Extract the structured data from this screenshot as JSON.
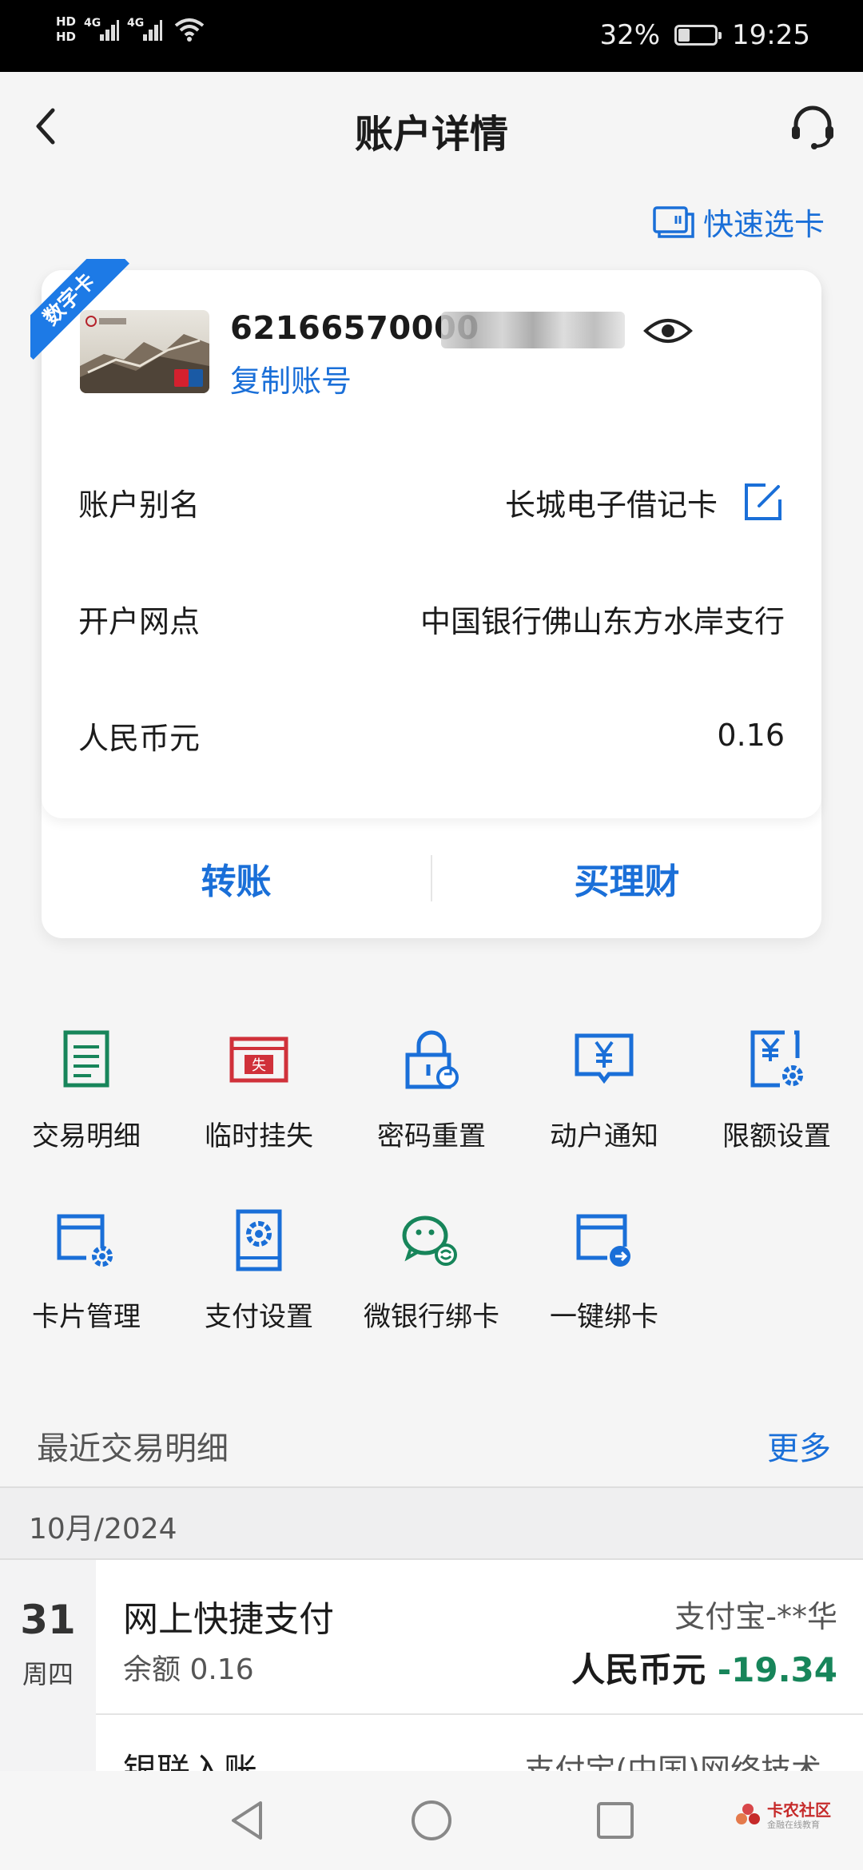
{
  "status_bar": {
    "battery": "32%",
    "battery_level": 0.32,
    "time": "19:25",
    "hd1": "HD",
    "hd2": "HD",
    "net1": "4G",
    "net2": "4G"
  },
  "header": {
    "title": "账户详情",
    "back_icon": "chevron-left-icon",
    "service_icon": "headset-icon"
  },
  "quick_select": {
    "label": "快速选卡",
    "icon": "card-select-icon"
  },
  "card": {
    "badge": "数字卡",
    "account_number": "62166570000",
    "copy_label": "复制账号",
    "rows": [
      {
        "label": "账户别名",
        "value": "长城电子借记卡"
      },
      {
        "label": "开户网点",
        "value": "中国银行佛山东方水岸支行"
      },
      {
        "label": "人民币元",
        "value": "0.16"
      }
    ],
    "actions": {
      "transfer": "转账",
      "buy": "买理财"
    }
  },
  "functions": [
    {
      "label": "交易明细",
      "icon": "ledger-icon",
      "color": "#17855a"
    },
    {
      "label": "临时挂失",
      "icon": "report-loss-icon",
      "color": "#d0313a"
    },
    {
      "label": "密码重置",
      "icon": "lock-reset-icon",
      "color": "#1a6fd8"
    },
    {
      "label": "动户通知",
      "icon": "yuan-notice-icon",
      "color": "#1a6fd8"
    },
    {
      "label": "限额设置",
      "icon": "yuan-settings-icon",
      "color": "#1a6fd8"
    },
    {
      "label": "卡片管理",
      "icon": "card-settings-icon",
      "color": "#1a6fd8"
    },
    {
      "label": "支付设置",
      "icon": "payment-settings-icon",
      "color": "#1a6fd8"
    },
    {
      "label": "微银行绑卡",
      "icon": "wechat-icon",
      "color": "#17855a"
    },
    {
      "label": "一键绑卡",
      "icon": "card-link-icon",
      "color": "#1a6fd8"
    }
  ],
  "recent": {
    "title": "最近交易明细",
    "more": "更多",
    "month": "10月/2024",
    "transactions": [
      {
        "day": "31",
        "weekday": "周四",
        "name": "网上快捷支付",
        "balance": "余额 0.16",
        "counterparty": "支付宝-**华",
        "currency": "人民币元",
        "amount": "-19.34"
      },
      {
        "name": "银联入账",
        "counterparty": "支付宝(中国)网络技术"
      }
    ]
  },
  "watermark": {
    "main": "卡农社区",
    "sub": "金融在线教育"
  },
  "colors": {
    "accent": "#1a6fd8",
    "green": "#17855a",
    "red": "#d0313a"
  }
}
